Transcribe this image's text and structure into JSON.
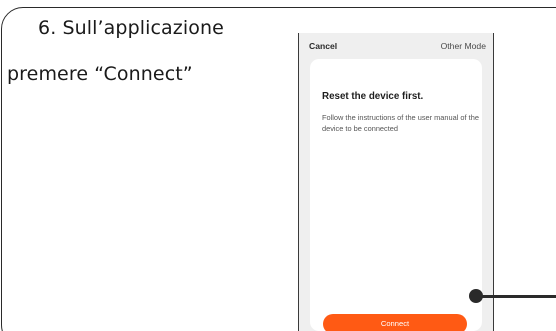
{
  "instruction": {
    "line1": "6. Sull’applicazione",
    "line2": "premere “Connect”"
  },
  "phone": {
    "topbar": {
      "cancel_label": "Cancel",
      "other_mode_label": "Other Mode"
    },
    "card": {
      "title": "Reset the device first.",
      "description": "Follow the instructions of the user manual of the device to be connected",
      "connect_label": "Connect"
    }
  },
  "colors": {
    "accent": "#ff5a14",
    "screen_background": "#efefef",
    "card_background": "#ffffff",
    "outline": "#2a2a2a"
  }
}
